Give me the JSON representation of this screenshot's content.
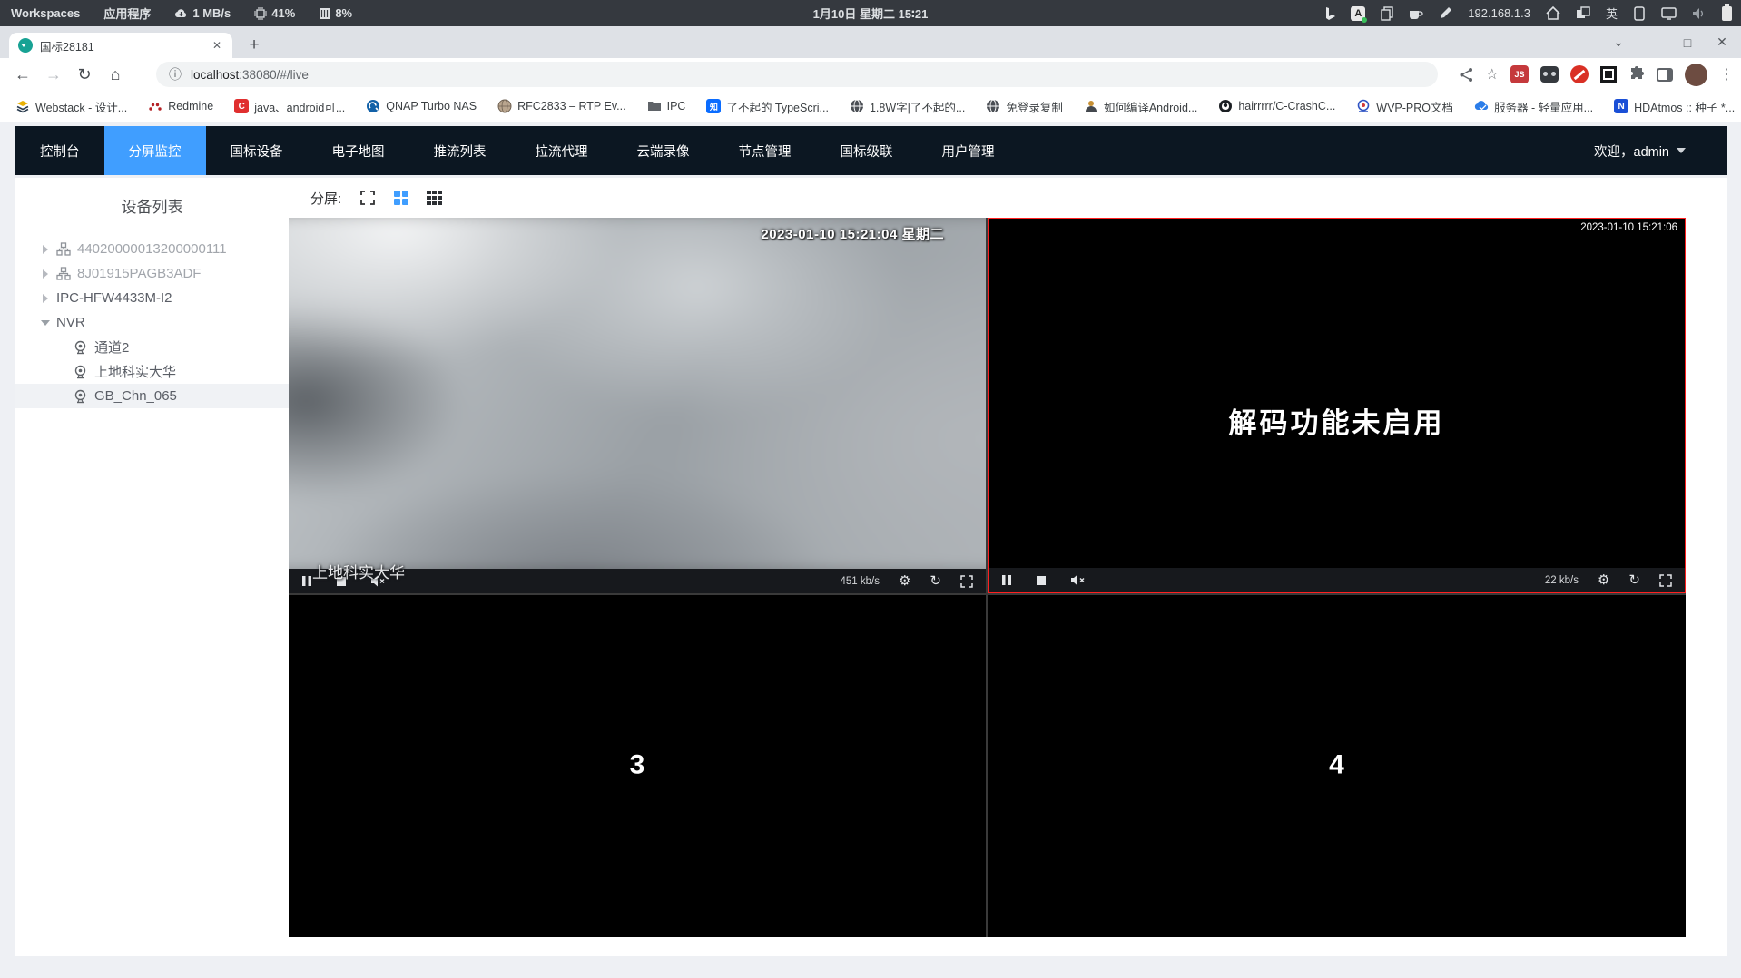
{
  "system_bar": {
    "workspaces": "Workspaces",
    "applications": "应用程序",
    "network_rate": "1 MB/s",
    "cpu": "41%",
    "memory": "8%",
    "clock": "1月10日 星期二 15∶21",
    "ip": "192.168.1.3",
    "input_lang": "英"
  },
  "browser": {
    "tab_title": "国标28181",
    "url_host": "localhost",
    "url_rest": ":38080/#/live",
    "ext_js_label": "JS",
    "icons": {
      "tab_search": "⌄",
      "minimize": "–",
      "maximize": "□",
      "close": "✕",
      "new_tab": "+",
      "tab_close": "✕",
      "back": "←",
      "forward": "→",
      "reload": "↻",
      "home": "⌂",
      "info": "ⓘ",
      "star": "☆",
      "menu": "⋮",
      "overflow": "»"
    },
    "bookmarks": [
      {
        "label": "Webstack - 设计..."
      },
      {
        "label": "Redmine"
      },
      {
        "label": "java、android可..."
      },
      {
        "label": "QNAP Turbo NAS"
      },
      {
        "label": "RFC2833 – RTP Ev..."
      },
      {
        "label": "IPC"
      },
      {
        "label": "了不起的 TypeScri..."
      },
      {
        "label": "1.8W字|了不起的..."
      },
      {
        "label": "免登录复制"
      },
      {
        "label": "如何编译Android..."
      },
      {
        "label": "hairrrrr/C-CrashC..."
      },
      {
        "label": "WVP-PRO文档"
      },
      {
        "label": "服务器 - 轻量应用..."
      },
      {
        "label": "HDAtmos :: 种子 *..."
      }
    ]
  },
  "app": {
    "nav": {
      "items": [
        {
          "label": "控制台"
        },
        {
          "label": "分屏监控",
          "active": true
        },
        {
          "label": "国标设备"
        },
        {
          "label": "电子地图"
        },
        {
          "label": "推流列表"
        },
        {
          "label": "拉流代理"
        },
        {
          "label": "云端录像"
        },
        {
          "label": "节点管理"
        },
        {
          "label": "国标级联"
        },
        {
          "label": "用户管理"
        }
      ],
      "welcome": "欢迎，admin"
    },
    "sidebar": {
      "title": "设备列表",
      "tree": [
        {
          "label": "44020000013200000111",
          "level": 1,
          "type": "platform",
          "muted": true
        },
        {
          "label": "8J01915PAGB3ADF",
          "level": 1,
          "type": "platform",
          "muted": true
        },
        {
          "label": "IPC-HFW4433M-I2",
          "level": 1,
          "type": "device"
        },
        {
          "label": "NVR",
          "level": 1,
          "type": "device",
          "expanded": true
        },
        {
          "label": "通道2",
          "level": 2,
          "type": "channel"
        },
        {
          "label": "上地科实大华",
          "level": 2,
          "type": "channel"
        },
        {
          "label": "GB_Chn_065",
          "level": 2,
          "type": "channel",
          "selected": true
        }
      ]
    },
    "toolbar": {
      "split_label": "分屏:"
    },
    "players": {
      "p1": {
        "timestamp": "2023-01-10 15:21:04 星期二",
        "camera_name": "上地科实大华",
        "bitrate": "451 kb/s"
      },
      "p2": {
        "timestamp": "2023-01-10 15:21:06",
        "message": "解码功能未启用",
        "bitrate": "22 kb/s"
      },
      "cell3_label": "3",
      "cell4_label": "4",
      "icons": {
        "gear": "⚙",
        "refresh": "↻"
      }
    },
    "colors": {
      "accent": "#409eff",
      "navbar_bg": "#0c1722",
      "selected_window_border": "#ff1f1f"
    }
  }
}
